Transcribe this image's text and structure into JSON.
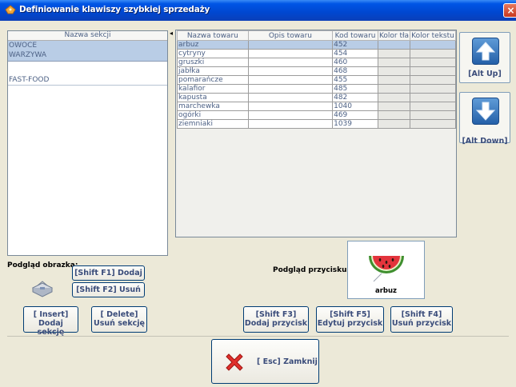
{
  "window": {
    "title": "Definiowanie klawiszy szybkiej sprzedaży",
    "close_glyph": "×"
  },
  "sections": {
    "header": "Nazwa sekcji",
    "items": [
      {
        "line1": "OWOCE",
        "line2": "WARZYWA",
        "selected": true
      },
      {
        "line1": "FAST-FOOD",
        "line2": "",
        "selected": false
      }
    ]
  },
  "splitter": {
    "arrow_glyph": "◂"
  },
  "products": {
    "columns": [
      "Nazwa towaru",
      "Opis towaru",
      "Kod towaru",
      "Kolor tła",
      "Kolor tekstu"
    ],
    "rows": [
      {
        "name": "arbuz",
        "desc": "",
        "code": "452",
        "selected": true
      },
      {
        "name": "cytryny",
        "desc": "",
        "code": "454",
        "selected": false
      },
      {
        "name": "gruszki",
        "desc": "",
        "code": "460",
        "selected": false
      },
      {
        "name": "jabłka",
        "desc": "",
        "code": "468",
        "selected": false
      },
      {
        "name": "pomarańcze",
        "desc": "",
        "code": "455",
        "selected": false
      },
      {
        "name": "kalafior",
        "desc": "",
        "code": "485",
        "selected": false
      },
      {
        "name": "kapusta",
        "desc": "",
        "code": "482",
        "selected": false
      },
      {
        "name": "marchewka",
        "desc": "",
        "code": "1040",
        "selected": false
      },
      {
        "name": "ogórki",
        "desc": "",
        "code": "469",
        "selected": false
      },
      {
        "name": "ziemniaki",
        "desc": "",
        "code": "1039",
        "selected": false
      }
    ]
  },
  "nav": {
    "up_label": "[Alt Up]",
    "down_label": "[Alt Down]"
  },
  "image_preview": {
    "label": "Podgląd obrazka:",
    "add_button": "[Shift F1] Dodaj",
    "remove_button": "[Shift F2] Usuń"
  },
  "section_buttons": {
    "insert_line1": "[ Insert]",
    "insert_line2": "Dodaj sekcję",
    "delete_line1": "[ Delete]",
    "delete_line2": "Usuń sekcję"
  },
  "button_preview": {
    "label": "Podgląd przycisku:",
    "caption": "arbuz"
  },
  "product_buttons": {
    "add_line1": "[Shift F3]",
    "add_line2": "Dodaj przycisk",
    "edit_line1": "[Shift F5]",
    "edit_line2": "Edytuj przycisk",
    "remove_line1": "[Shift F4]",
    "remove_line2": "Usuń przycisk"
  },
  "footer": {
    "close_label": "[ Esc] Zamknij"
  },
  "colors": {
    "selection": "#b9cde6",
    "title_bar": "#0055e5",
    "button_text": "#3a4c7a",
    "arrow_blue": "#2f6db5"
  }
}
